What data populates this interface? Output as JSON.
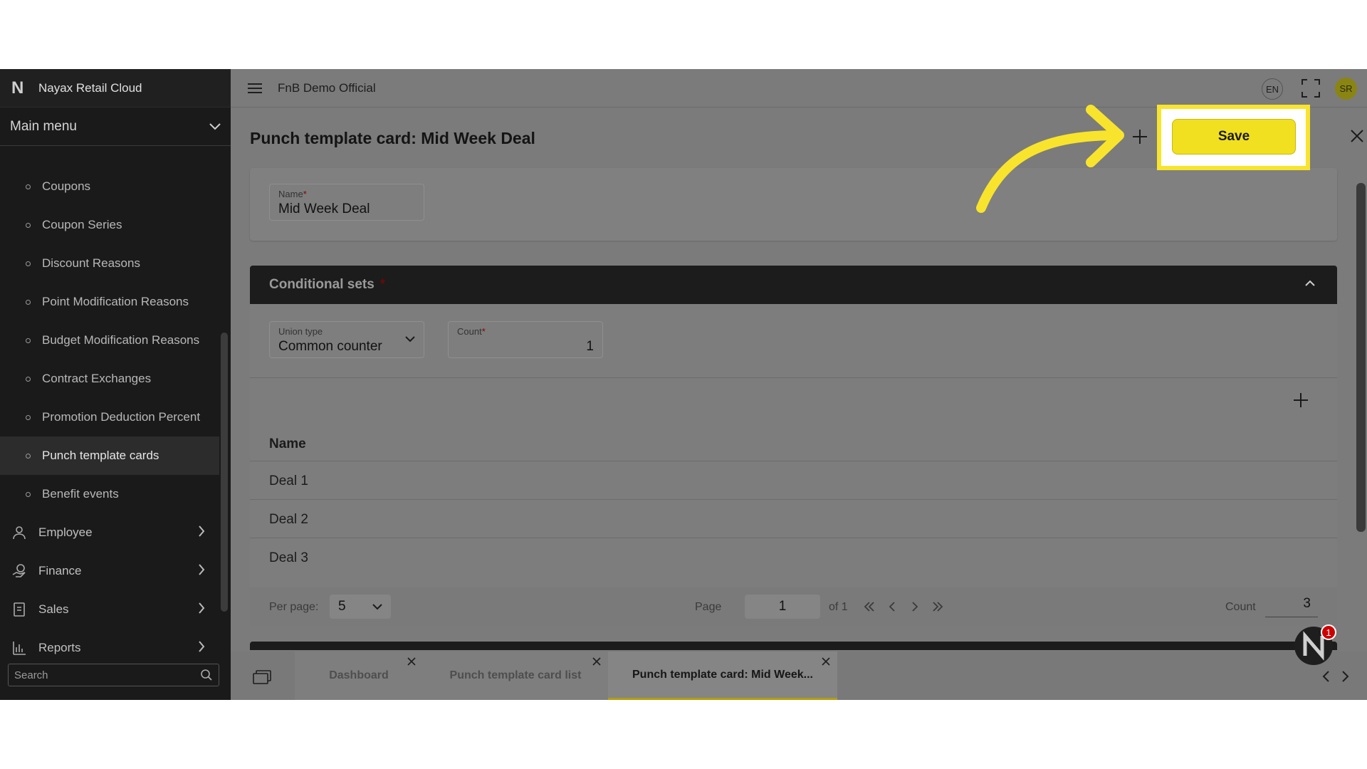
{
  "app": {
    "brand_logo": "N",
    "brand_name": "Nayax Retail Cloud",
    "company": "FnB Demo Official",
    "language": "EN",
    "user_initials": "SR"
  },
  "sidebar": {
    "main_menu_label": "Main menu",
    "sub_items": [
      {
        "label": "Coupons"
      },
      {
        "label": "Coupon Series"
      },
      {
        "label": "Discount Reasons"
      },
      {
        "label": "Point Modification Reasons"
      },
      {
        "label": "Budget Modification Reasons"
      },
      {
        "label": "Contract Exchanges"
      },
      {
        "label": "Promotion Deduction Percent"
      },
      {
        "label": "Punch template cards",
        "active": true
      },
      {
        "label": "Benefit events"
      }
    ],
    "sections": [
      {
        "label": "Employee",
        "icon": "employee-icon"
      },
      {
        "label": "Finance",
        "icon": "finance-icon"
      },
      {
        "label": "Sales",
        "icon": "sales-icon"
      },
      {
        "label": "Reports",
        "icon": "reports-icon"
      }
    ],
    "search_placeholder": "Search"
  },
  "page": {
    "title": "Punch template card: Mid Week Deal",
    "save_label": "Save",
    "name_field": {
      "label": "Name",
      "required_mark": "*",
      "value": "Mid Week Deal"
    }
  },
  "conditional_sets": {
    "title": "Conditional sets",
    "required_mark": "*",
    "union_type": {
      "label": "Union type",
      "value": "Common counter"
    },
    "count": {
      "label": "Count",
      "required_mark": "*",
      "value": "1"
    },
    "table": {
      "header": "Name",
      "rows": [
        "Deal 1",
        "Deal 2",
        "Deal 3"
      ]
    },
    "pager": {
      "per_page_label": "Per page:",
      "per_page_value": "5",
      "page_label": "Page",
      "page_value": "1",
      "of_label": "of 1",
      "count_label": "Count",
      "count_value": "3"
    }
  },
  "tabs": [
    {
      "label": "Dashboard"
    },
    {
      "label": "Punch template card list"
    },
    {
      "label": "Punch template card: Mid Week...",
      "active": true
    }
  ],
  "notification_count": "1",
  "colors": {
    "highlight": "#f8e42c",
    "save_button": "#f1e01f",
    "sidebar_bg": "#1a1a1a",
    "overlay_bg": "#7b7b7b",
    "required": "#8b0000"
  }
}
